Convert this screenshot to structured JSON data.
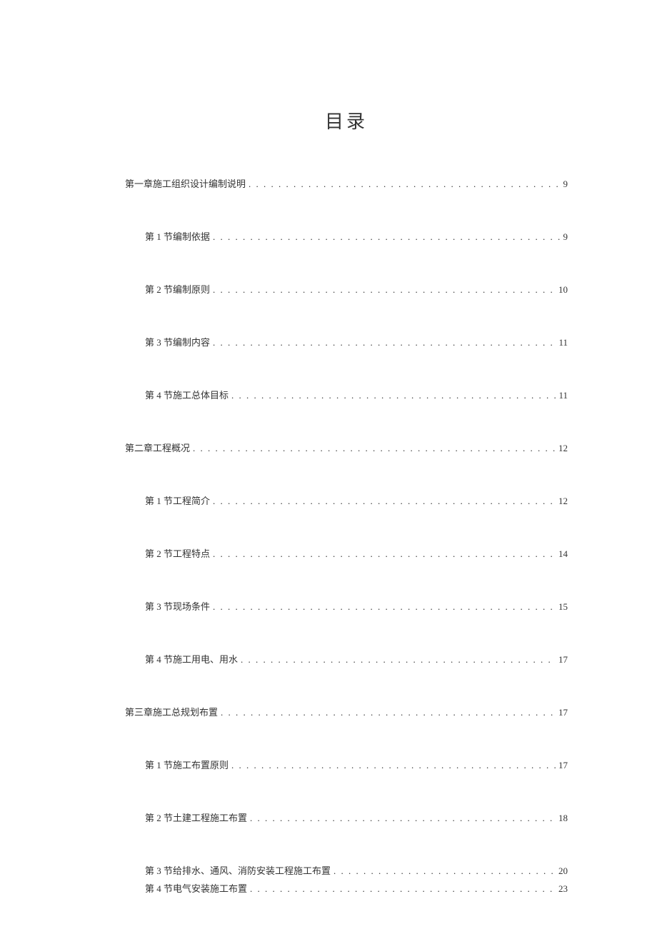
{
  "title": "目录",
  "toc": [
    {
      "level": 1,
      "label": "第一章施工组织设计编制说明",
      "page": "9",
      "tight": false
    },
    {
      "level": 2,
      "label": "第 1 节编制依据",
      "page": "9",
      "tight": false
    },
    {
      "level": 2,
      "label": "第 2 节编制原则",
      "page": "10",
      "tight": false
    },
    {
      "level": 2,
      "label": "第 3 节编制内容",
      "page": "11",
      "tight": false
    },
    {
      "level": 2,
      "label": "第 4 节施工总体目标",
      "page": "11",
      "tight": false
    },
    {
      "level": 1,
      "label": "第二章工程概况",
      "page": "12",
      "tight": false
    },
    {
      "level": 2,
      "label": "第 1 节工程简介",
      "page": "12",
      "tight": false
    },
    {
      "level": 2,
      "label": "第 2 节工程特点",
      "page": "14",
      "tight": false
    },
    {
      "level": 2,
      "label": "第 3 节现场条件",
      "page": "15",
      "tight": false
    },
    {
      "level": 2,
      "label": "第 4 节施工用电、用水",
      "page": "17",
      "tight": false
    },
    {
      "level": 1,
      "label": "第三章施工总规划布置",
      "page": "17",
      "tight": false
    },
    {
      "level": 2,
      "label": "第 1 节施工布置原则",
      "page": "17",
      "tight": false
    },
    {
      "level": 2,
      "label": "第 2 节土建工程施工布置",
      "page": "18",
      "tight": false
    },
    {
      "level": 2,
      "label": "第 3 节给排水、通风、消防安装工程施工布置",
      "page": "20",
      "tight": true
    },
    {
      "level": 2,
      "label": "第 4 节电气安装施工布置",
      "page": "23",
      "tight": false
    }
  ]
}
